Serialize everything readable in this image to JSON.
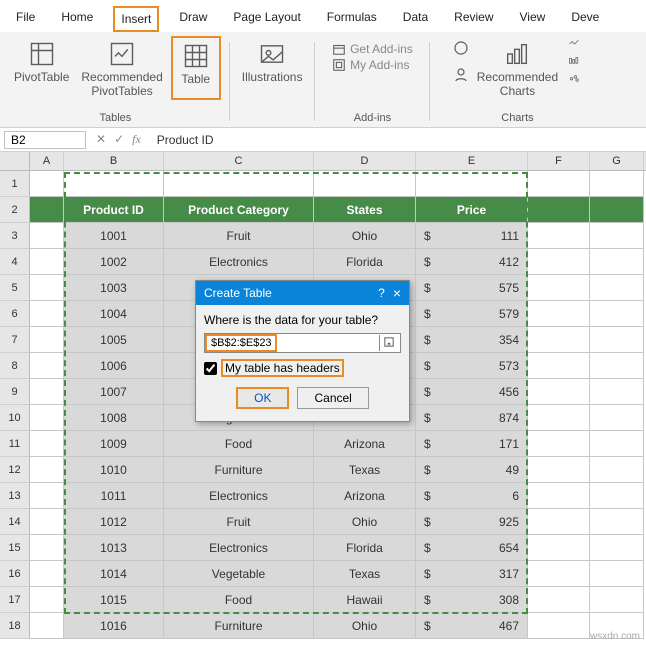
{
  "tabs": {
    "file": "File",
    "home": "Home",
    "insert": "Insert",
    "draw": "Draw",
    "page_layout": "Page Layout",
    "formulas": "Formulas",
    "data": "Data",
    "review": "Review",
    "view": "View",
    "deve": "Deve"
  },
  "ribbon": {
    "tables": {
      "pivot": "PivotTable",
      "recommended": "Recommended\nPivotTables",
      "table": "Table",
      "group": "Tables"
    },
    "illustrations": {
      "btn": "Illustrations"
    },
    "addins": {
      "get": "Get Add-ins",
      "my": "My Add-ins",
      "group": "Add-ins"
    },
    "charts": {
      "recommended": "Recommended\nCharts",
      "group": "Charts"
    }
  },
  "fbar": {
    "name": "B2",
    "fx": "fx",
    "formula": "Product ID"
  },
  "columns": {
    "A": "A",
    "B": "B",
    "C": "C",
    "D": "D",
    "E": "E",
    "F": "F",
    "G": "G"
  },
  "headers": {
    "b": "Product ID",
    "c": "Product Category",
    "d": "States",
    "e": "Price"
  },
  "rows": [
    {
      "n": "2",
      "b": "Product ID",
      "c": "Product Category",
      "d": "States",
      "e": "Price",
      "header": true
    },
    {
      "n": "3",
      "b": "1001",
      "c": "Fruit",
      "d": "Ohio",
      "e": "111"
    },
    {
      "n": "4",
      "b": "1002",
      "c": "Electronics",
      "d": "Florida",
      "e": "412"
    },
    {
      "n": "5",
      "b": "1003",
      "c": "",
      "d": "",
      "e": "575"
    },
    {
      "n": "6",
      "b": "1004",
      "c": "",
      "d": "ii",
      "e": "579"
    },
    {
      "n": "7",
      "b": "1005",
      "c": "",
      "d": "",
      "e": "354"
    },
    {
      "n": "8",
      "b": "1006",
      "c": "",
      "d": "a",
      "e": "573"
    },
    {
      "n": "9",
      "b": "1007",
      "c": "",
      "d": "s",
      "e": "456"
    },
    {
      "n": "10",
      "b": "1008",
      "c": "Vegetable",
      "d": "California",
      "e": "874"
    },
    {
      "n": "11",
      "b": "1009",
      "c": "Food",
      "d": "Arizona",
      "e": "171"
    },
    {
      "n": "12",
      "b": "1010",
      "c": "Furniture",
      "d": "Texas",
      "e": "49"
    },
    {
      "n": "13",
      "b": "1011",
      "c": "Electronics",
      "d": "Arizona",
      "e": "6"
    },
    {
      "n": "14",
      "b": "1012",
      "c": "Fruit",
      "d": "Ohio",
      "e": "925"
    },
    {
      "n": "15",
      "b": "1013",
      "c": "Electronics",
      "d": "Florida",
      "e": "654"
    },
    {
      "n": "16",
      "b": "1014",
      "c": "Vegetable",
      "d": "Texas",
      "e": "317"
    },
    {
      "n": "17",
      "b": "1015",
      "c": "Food",
      "d": "Hawaii",
      "e": "308"
    },
    {
      "n": "18",
      "b": "1016",
      "c": "Furniture",
      "d": "Ohio",
      "e": "467"
    }
  ],
  "row1": "1",
  "dialog": {
    "title": "Create Table",
    "help": "?",
    "close": "×",
    "prompt": "Where is the data for your table?",
    "range": "$B$2:$E$23",
    "headers_label": "My table has headers",
    "ok": "OK",
    "cancel": "Cancel"
  },
  "dollar": "$",
  "watermark": "wsxdn.com",
  "chart_data": {
    "type": "table",
    "columns": [
      "Product ID",
      "Product Category",
      "States",
      "Price"
    ],
    "data": [
      [
        1001,
        "Fruit",
        "Ohio",
        111
      ],
      [
        1002,
        "Electronics",
        "Florida",
        412
      ],
      [
        1003,
        null,
        null,
        575
      ],
      [
        1004,
        null,
        null,
        579
      ],
      [
        1005,
        null,
        null,
        354
      ],
      [
        1006,
        null,
        null,
        573
      ],
      [
        1007,
        null,
        null,
        456
      ],
      [
        1008,
        "Vegetable",
        "California",
        874
      ],
      [
        1009,
        "Food",
        "Arizona",
        171
      ],
      [
        1010,
        "Furniture",
        "Texas",
        49
      ],
      [
        1011,
        "Electronics",
        "Arizona",
        6
      ],
      [
        1012,
        "Fruit",
        "Ohio",
        925
      ],
      [
        1013,
        "Electronics",
        "Florida",
        654
      ],
      [
        1014,
        "Vegetable",
        "Texas",
        317
      ],
      [
        1015,
        "Food",
        "Hawaii",
        308
      ],
      [
        1016,
        "Furniture",
        "Ohio",
        467
      ]
    ]
  }
}
